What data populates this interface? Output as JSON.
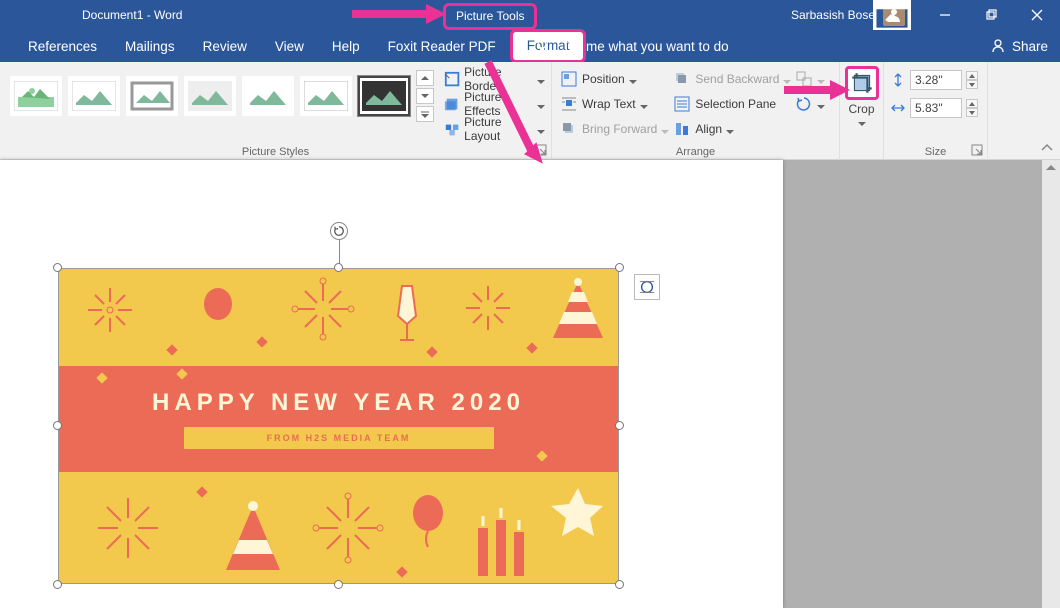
{
  "titlebar": {
    "document_title": "Document1 - Word",
    "contextual_tab": "Picture Tools",
    "user_name": "Sarbasish Bose"
  },
  "tabs": {
    "references": "References",
    "mailings": "Mailings",
    "review": "Review",
    "view": "View",
    "help": "Help",
    "foxit": "Foxit Reader PDF",
    "format": "Format",
    "tell_me": "Tell me what you want to do",
    "share": "Share"
  },
  "ribbon": {
    "picture_styles": {
      "group_label": "Picture Styles",
      "border": "Picture Border",
      "effects": "Picture Effects",
      "layout": "Picture Layout"
    },
    "arrange": {
      "group_label": "Arrange",
      "position": "Position",
      "wrap_text": "Wrap Text",
      "bring_forward": "Bring Forward",
      "send_backward": "Send Backward",
      "selection_pane": "Selection Pane",
      "align": "Align"
    },
    "crop": {
      "label": "Crop"
    },
    "size": {
      "group_label": "Size",
      "height": "3.28\"",
      "width": "5.83\""
    }
  },
  "card": {
    "headline": "HAPPY NEW YEAR 2020",
    "subline": "FROM H2S MEDIA TEAM"
  }
}
